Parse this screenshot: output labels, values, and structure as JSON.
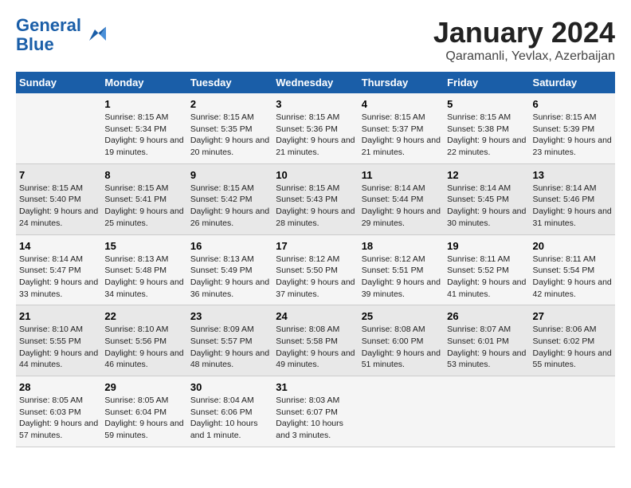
{
  "logo": {
    "line1": "General",
    "line2": "Blue"
  },
  "title": "January 2024",
  "subtitle": "Qaramanli, Yevlax, Azerbaijan",
  "days_of_week": [
    "Sunday",
    "Monday",
    "Tuesday",
    "Wednesday",
    "Thursday",
    "Friday",
    "Saturday"
  ],
  "weeks": [
    [
      {
        "day": "",
        "info": ""
      },
      {
        "day": "1",
        "sunrise": "Sunrise: 8:15 AM",
        "sunset": "Sunset: 5:34 PM",
        "daylight": "Daylight: 9 hours and 19 minutes."
      },
      {
        "day": "2",
        "sunrise": "Sunrise: 8:15 AM",
        "sunset": "Sunset: 5:35 PM",
        "daylight": "Daylight: 9 hours and 20 minutes."
      },
      {
        "day": "3",
        "sunrise": "Sunrise: 8:15 AM",
        "sunset": "Sunset: 5:36 PM",
        "daylight": "Daylight: 9 hours and 21 minutes."
      },
      {
        "day": "4",
        "sunrise": "Sunrise: 8:15 AM",
        "sunset": "Sunset: 5:37 PM",
        "daylight": "Daylight: 9 hours and 21 minutes."
      },
      {
        "day": "5",
        "sunrise": "Sunrise: 8:15 AM",
        "sunset": "Sunset: 5:38 PM",
        "daylight": "Daylight: 9 hours and 22 minutes."
      },
      {
        "day": "6",
        "sunrise": "Sunrise: 8:15 AM",
        "sunset": "Sunset: 5:39 PM",
        "daylight": "Daylight: 9 hours and 23 minutes."
      }
    ],
    [
      {
        "day": "7",
        "sunrise": "Sunrise: 8:15 AM",
        "sunset": "Sunset: 5:40 PM",
        "daylight": "Daylight: 9 hours and 24 minutes."
      },
      {
        "day": "8",
        "sunrise": "Sunrise: 8:15 AM",
        "sunset": "Sunset: 5:41 PM",
        "daylight": "Daylight: 9 hours and 25 minutes."
      },
      {
        "day": "9",
        "sunrise": "Sunrise: 8:15 AM",
        "sunset": "Sunset: 5:42 PM",
        "daylight": "Daylight: 9 hours and 26 minutes."
      },
      {
        "day": "10",
        "sunrise": "Sunrise: 8:15 AM",
        "sunset": "Sunset: 5:43 PM",
        "daylight": "Daylight: 9 hours and 28 minutes."
      },
      {
        "day": "11",
        "sunrise": "Sunrise: 8:14 AM",
        "sunset": "Sunset: 5:44 PM",
        "daylight": "Daylight: 9 hours and 29 minutes."
      },
      {
        "day": "12",
        "sunrise": "Sunrise: 8:14 AM",
        "sunset": "Sunset: 5:45 PM",
        "daylight": "Daylight: 9 hours and 30 minutes."
      },
      {
        "day": "13",
        "sunrise": "Sunrise: 8:14 AM",
        "sunset": "Sunset: 5:46 PM",
        "daylight": "Daylight: 9 hours and 31 minutes."
      }
    ],
    [
      {
        "day": "14",
        "sunrise": "Sunrise: 8:14 AM",
        "sunset": "Sunset: 5:47 PM",
        "daylight": "Daylight: 9 hours and 33 minutes."
      },
      {
        "day": "15",
        "sunrise": "Sunrise: 8:13 AM",
        "sunset": "Sunset: 5:48 PM",
        "daylight": "Daylight: 9 hours and 34 minutes."
      },
      {
        "day": "16",
        "sunrise": "Sunrise: 8:13 AM",
        "sunset": "Sunset: 5:49 PM",
        "daylight": "Daylight: 9 hours and 36 minutes."
      },
      {
        "day": "17",
        "sunrise": "Sunrise: 8:12 AM",
        "sunset": "Sunset: 5:50 PM",
        "daylight": "Daylight: 9 hours and 37 minutes."
      },
      {
        "day": "18",
        "sunrise": "Sunrise: 8:12 AM",
        "sunset": "Sunset: 5:51 PM",
        "daylight": "Daylight: 9 hours and 39 minutes."
      },
      {
        "day": "19",
        "sunrise": "Sunrise: 8:11 AM",
        "sunset": "Sunset: 5:52 PM",
        "daylight": "Daylight: 9 hours and 41 minutes."
      },
      {
        "day": "20",
        "sunrise": "Sunrise: 8:11 AM",
        "sunset": "Sunset: 5:54 PM",
        "daylight": "Daylight: 9 hours and 42 minutes."
      }
    ],
    [
      {
        "day": "21",
        "sunrise": "Sunrise: 8:10 AM",
        "sunset": "Sunset: 5:55 PM",
        "daylight": "Daylight: 9 hours and 44 minutes."
      },
      {
        "day": "22",
        "sunrise": "Sunrise: 8:10 AM",
        "sunset": "Sunset: 5:56 PM",
        "daylight": "Daylight: 9 hours and 46 minutes."
      },
      {
        "day": "23",
        "sunrise": "Sunrise: 8:09 AM",
        "sunset": "Sunset: 5:57 PM",
        "daylight": "Daylight: 9 hours and 48 minutes."
      },
      {
        "day": "24",
        "sunrise": "Sunrise: 8:08 AM",
        "sunset": "Sunset: 5:58 PM",
        "daylight": "Daylight: 9 hours and 49 minutes."
      },
      {
        "day": "25",
        "sunrise": "Sunrise: 8:08 AM",
        "sunset": "Sunset: 6:00 PM",
        "daylight": "Daylight: 9 hours and 51 minutes."
      },
      {
        "day": "26",
        "sunrise": "Sunrise: 8:07 AM",
        "sunset": "Sunset: 6:01 PM",
        "daylight": "Daylight: 9 hours and 53 minutes."
      },
      {
        "day": "27",
        "sunrise": "Sunrise: 8:06 AM",
        "sunset": "Sunset: 6:02 PM",
        "daylight": "Daylight: 9 hours and 55 minutes."
      }
    ],
    [
      {
        "day": "28",
        "sunrise": "Sunrise: 8:05 AM",
        "sunset": "Sunset: 6:03 PM",
        "daylight": "Daylight: 9 hours and 57 minutes."
      },
      {
        "day": "29",
        "sunrise": "Sunrise: 8:05 AM",
        "sunset": "Sunset: 6:04 PM",
        "daylight": "Daylight: 9 hours and 59 minutes."
      },
      {
        "day": "30",
        "sunrise": "Sunrise: 8:04 AM",
        "sunset": "Sunset: 6:06 PM",
        "daylight": "Daylight: 10 hours and 1 minute."
      },
      {
        "day": "31",
        "sunrise": "Sunrise: 8:03 AM",
        "sunset": "Sunset: 6:07 PM",
        "daylight": "Daylight: 10 hours and 3 minutes."
      },
      {
        "day": "",
        "info": ""
      },
      {
        "day": "",
        "info": ""
      },
      {
        "day": "",
        "info": ""
      }
    ]
  ]
}
